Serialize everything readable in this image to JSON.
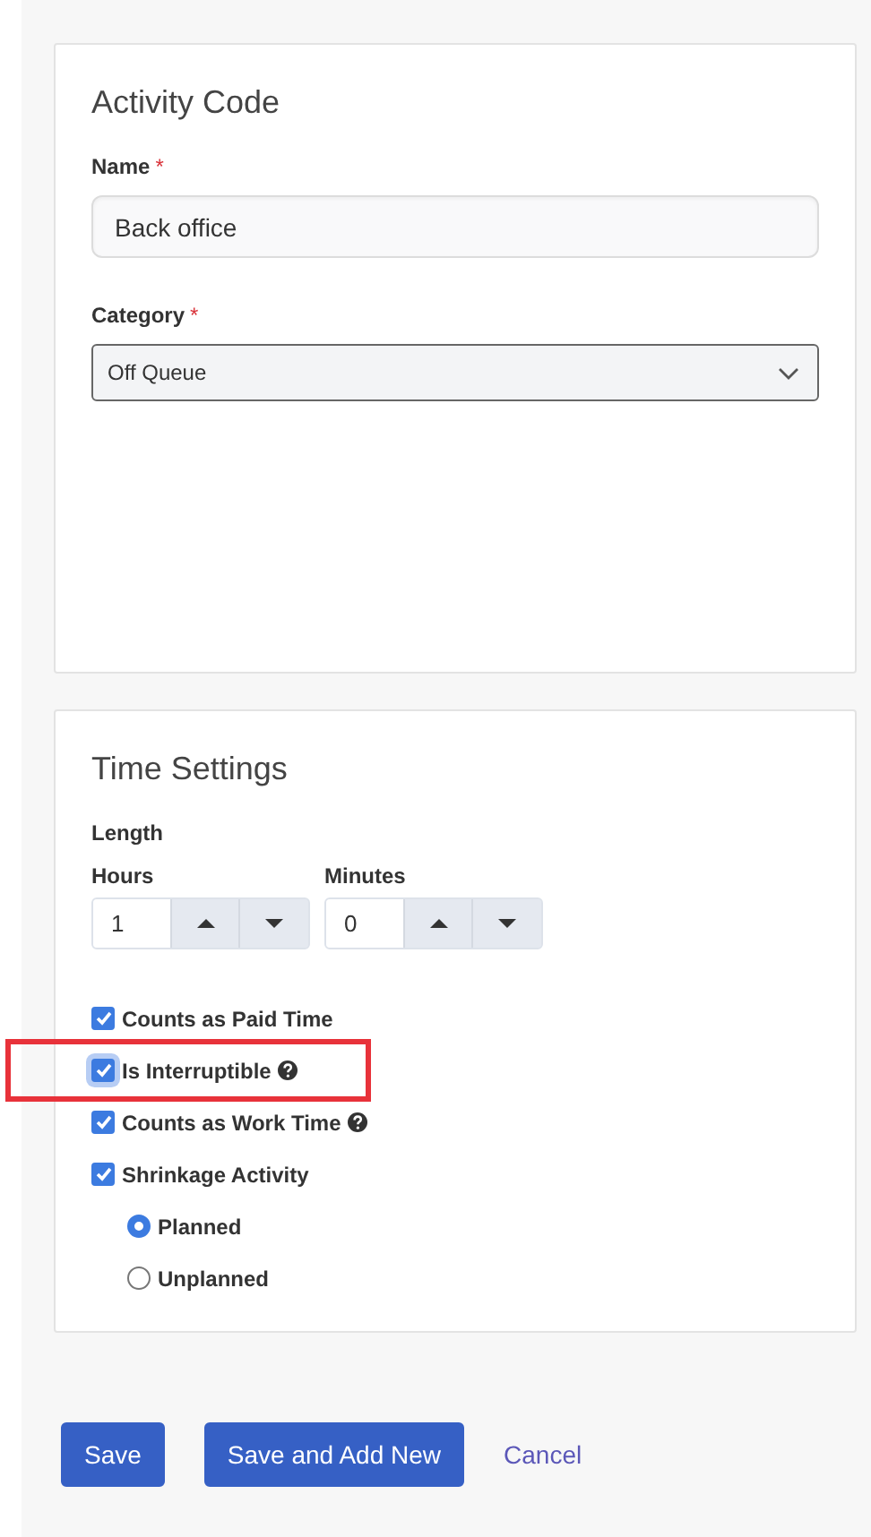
{
  "activity_card": {
    "title": "Activity Code",
    "name_field": {
      "label": "Name",
      "required_mark": "*",
      "value": "Back office"
    },
    "category_field": {
      "label": "Category",
      "required_mark": "*",
      "value": "Off Queue"
    }
  },
  "time_card": {
    "title": "Time Settings",
    "length_label": "Length",
    "spinners": [
      {
        "label": "Hours",
        "value": "1"
      },
      {
        "label": "Minutes",
        "value": "0"
      }
    ],
    "checkboxes": [
      {
        "label": "Counts as Paid Time",
        "checked": true,
        "help": false,
        "highlighted": false,
        "focused": false
      },
      {
        "label": "Is Interruptible",
        "checked": true,
        "help": true,
        "highlighted": true,
        "focused": true
      },
      {
        "label": "Counts as Work Time",
        "checked": true,
        "help": true,
        "highlighted": false,
        "focused": false
      },
      {
        "label": "Shrinkage Activity",
        "checked": true,
        "help": false,
        "highlighted": false,
        "focused": false
      }
    ],
    "radios": [
      {
        "label": "Planned",
        "selected": true
      },
      {
        "label": "Unplanned",
        "selected": false
      }
    ]
  },
  "actions": [
    {
      "label": "Save",
      "kind": "primary"
    },
    {
      "label": "Save and Add New",
      "kind": "primary"
    },
    {
      "label": "Cancel",
      "kind": "link"
    }
  ]
}
